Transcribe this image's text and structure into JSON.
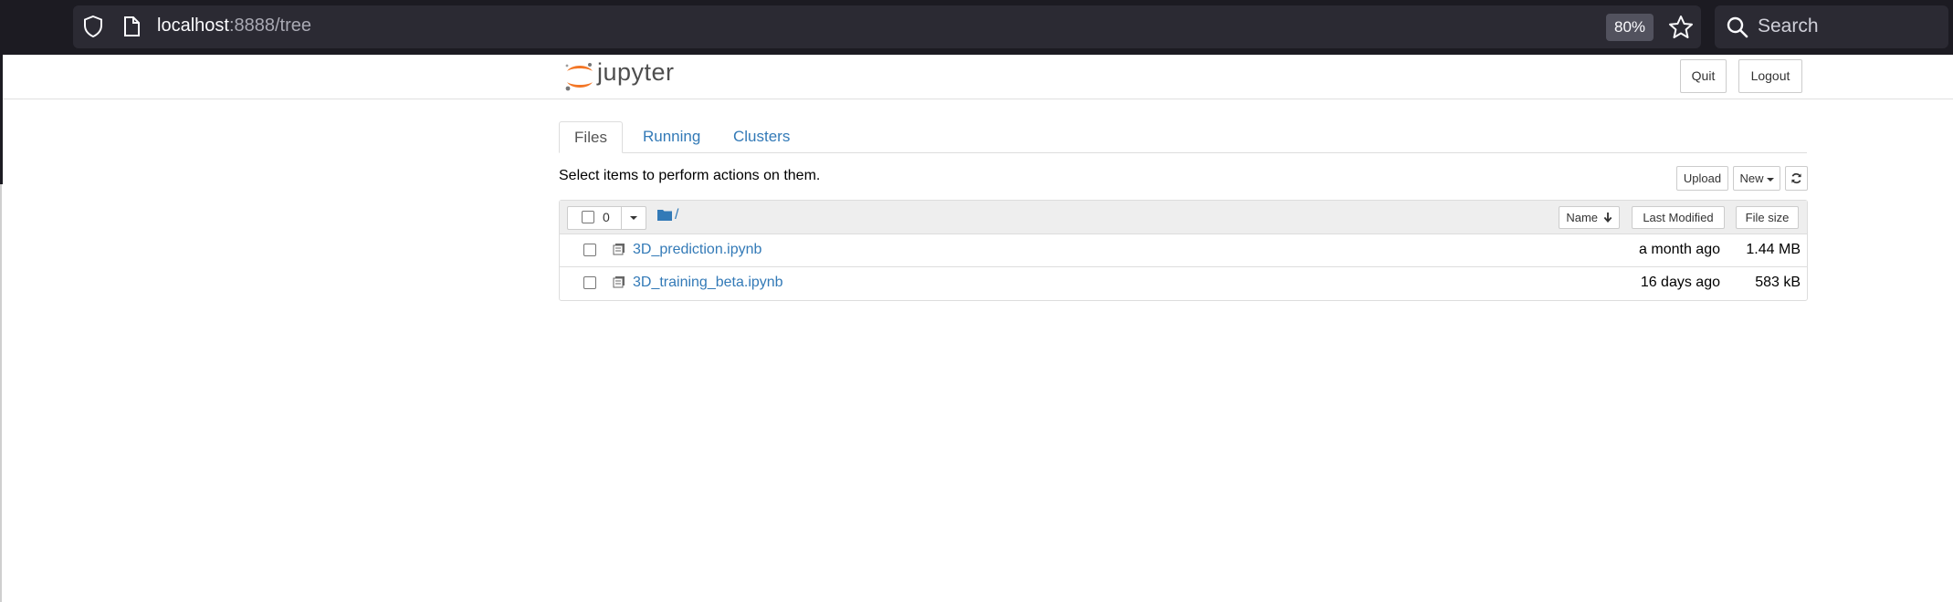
{
  "browser": {
    "url_host": "localhost",
    "url_path": ":8888/tree",
    "zoom": "80%",
    "search_placeholder": "Search"
  },
  "header": {
    "logo_text": "jupyter",
    "quit_label": "Quit",
    "logout_label": "Logout"
  },
  "tabs": [
    {
      "label": "Files",
      "active": true
    },
    {
      "label": "Running",
      "active": false
    },
    {
      "label": "Clusters",
      "active": false
    }
  ],
  "toolbar": {
    "hint": "Select items to perform actions on them.",
    "upload_label": "Upload",
    "new_label": "New"
  },
  "list": {
    "selected_count": "0",
    "breadcrumb": "/",
    "columns": {
      "name": "Name",
      "last_modified": "Last Modified",
      "file_size": "File size"
    },
    "files": [
      {
        "name": "3D_prediction.ipynb",
        "modified": "a month ago",
        "size": "1.44 MB"
      },
      {
        "name": "3D_training_beta.ipynb",
        "modified": "16 days ago",
        "size": "583 kB"
      }
    ]
  },
  "colors": {
    "link": "#337ab7",
    "browser_bg": "#1c1b22",
    "jupyter_orange": "#f37626"
  }
}
